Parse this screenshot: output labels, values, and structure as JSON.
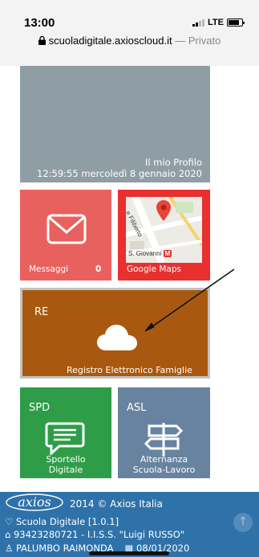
{
  "status_bar": {
    "time": "13:00",
    "network": "LTE"
  },
  "address_bar": {
    "url": "scuoladigitale.axioscloud.it",
    "separator": " — ",
    "mode": "Privato"
  },
  "tiles": {
    "profile": {
      "title": "Il mio Profilo",
      "datetime": "12:59:55 mercoledì 8 gennaio 2020",
      "color": "#8f9ea5"
    },
    "messages": {
      "label": "Messaggi",
      "count": "0",
      "icon": "envelope-icon",
      "color": "#e9615e"
    },
    "maps": {
      "label": "Google Maps",
      "map_street": "e Filiberto",
      "map_place": "S. Giovanni",
      "metro_badge": "M",
      "icon": "map-pin-icon",
      "color": "#e8302f"
    },
    "re": {
      "code": "RE",
      "label": "Registro Elettronico Famiglie",
      "icon": "cloud-icon",
      "color": "#a9590f"
    },
    "spd": {
      "code": "SPD",
      "label_line1": "Sportello",
      "label_line2": "Digitale",
      "icon": "chat-icon",
      "color": "#2f9d48"
    },
    "asl": {
      "code": "ASL",
      "label_line1": "Alternanza",
      "label_line2": "Scuola-Lavoro",
      "icon": "signpost-icon",
      "color": "#68839f"
    }
  },
  "footer": {
    "brand": "axios",
    "copyright": "2014 © Axios Italia",
    "app": "Scuola Digitale [1.0.1]",
    "school": "93423280721 - I.I.S.S. \"Luigi RUSSO\"",
    "user": "PALUMBO RAIMONDA",
    "date": "08/01/2020",
    "color": "#2f72a9"
  }
}
